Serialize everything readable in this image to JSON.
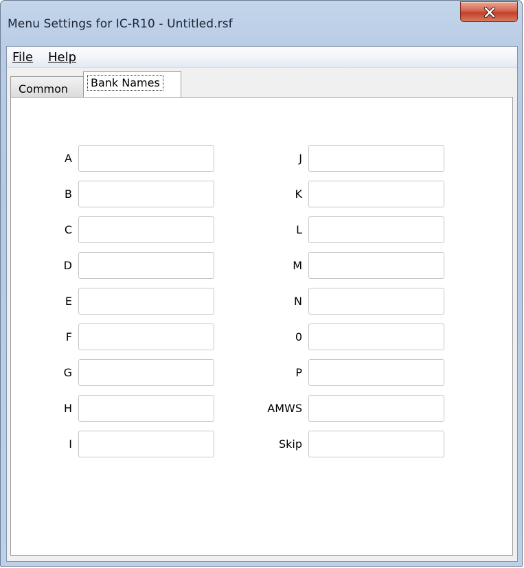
{
  "window": {
    "title": "Menu Settings for IC-R10 - Untitled.rsf"
  },
  "menu": {
    "file": "File",
    "help": "Help"
  },
  "tabs": {
    "common": "Common",
    "bank_names": "Bank Names",
    "active": "bank_names"
  },
  "bank_fields": {
    "left": [
      {
        "label": "A",
        "value": ""
      },
      {
        "label": "B",
        "value": ""
      },
      {
        "label": "C",
        "value": ""
      },
      {
        "label": "D",
        "value": ""
      },
      {
        "label": "E",
        "value": ""
      },
      {
        "label": "F",
        "value": ""
      },
      {
        "label": "G",
        "value": ""
      },
      {
        "label": "H",
        "value": ""
      },
      {
        "label": "I",
        "value": ""
      }
    ],
    "right": [
      {
        "label": "J",
        "value": ""
      },
      {
        "label": "K",
        "value": ""
      },
      {
        "label": "L",
        "value": ""
      },
      {
        "label": "M",
        "value": ""
      },
      {
        "label": "N",
        "value": ""
      },
      {
        "label": "0",
        "value": ""
      },
      {
        "label": "P",
        "value": ""
      },
      {
        "label": "AMWS",
        "value": ""
      },
      {
        "label": "Skip",
        "value": ""
      }
    ]
  },
  "icons": {
    "close": "close-icon"
  },
  "colors": {
    "close_button": "#c8462f",
    "title_bar": "#b9cde6"
  }
}
